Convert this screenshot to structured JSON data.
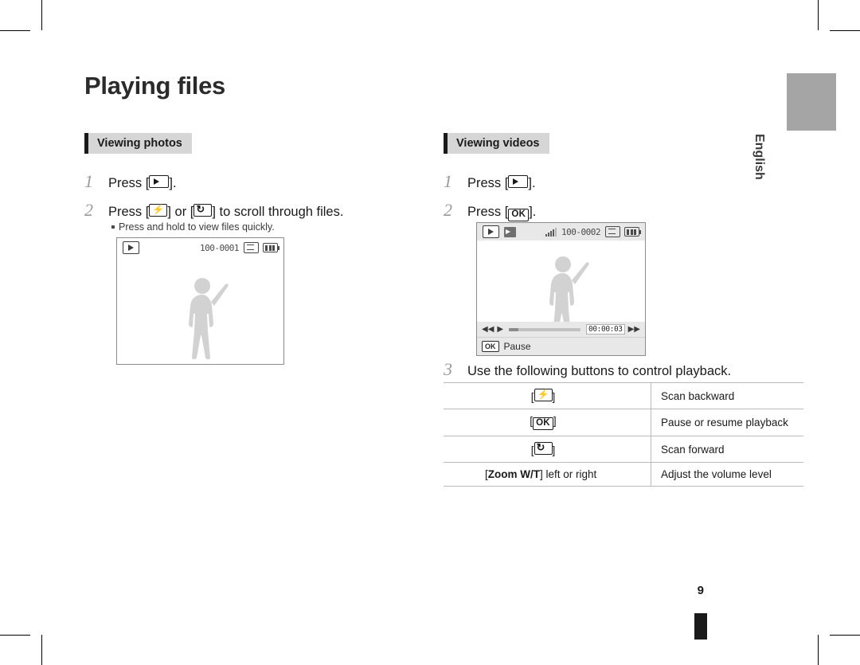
{
  "page": {
    "title": "Playing files",
    "number": "9",
    "side_tab_label": "English"
  },
  "sections": {
    "photos": {
      "heading": "Viewing photos",
      "steps": [
        {
          "num": "1",
          "pre": "Press [",
          "post": "]."
        },
        {
          "num": "2",
          "pre": "Press [",
          "mid": "] or [",
          "post": "] to scroll through files."
        }
      ],
      "note": "Press and hold to view files quickly.",
      "screen": {
        "file_number": "100-0001",
        "icons": [
          "play-icon",
          "memory-card-icon",
          "battery-icon"
        ]
      }
    },
    "videos": {
      "heading": "Viewing videos",
      "steps": [
        {
          "num": "1",
          "pre": "Press [",
          "post": "]."
        },
        {
          "num": "2",
          "pre": "Press [",
          "post": "]."
        },
        {
          "num": "3",
          "text": "Use the following buttons to control playback."
        }
      ],
      "screen": {
        "file_number": "100-0002",
        "timecode": "00:00:03",
        "status_ok": "OK",
        "status_text": "Pause",
        "icons": [
          "play-icon",
          "movie-icon",
          "signal-icon",
          "memory-card-icon",
          "battery-icon",
          "rewind-icon",
          "play-small-icon",
          "fast-forward-icon"
        ]
      },
      "table": {
        "rows": [
          {
            "button": "flash-key",
            "label": "[",
            "label_end": "]",
            "action": "Scan backward"
          },
          {
            "button": "ok-key",
            "label": "[",
            "label_text": "OK",
            "label_end": "]",
            "action": "Pause or resume playback"
          },
          {
            "button": "timer-key",
            "label": "[",
            "label_end": "]",
            "action": "Scan forward"
          },
          {
            "button": "zoom-key",
            "label_pre": "[",
            "label_bold": "Zoom W/T",
            "label_post": "] left or right",
            "action": "Adjust the volume level"
          }
        ]
      }
    }
  },
  "colors": {
    "heading_bg": "#d6d6d6",
    "heading_bar": "#1a1a1a",
    "step_number": "#9a9a9a",
    "side_tab": "#a5a5a5",
    "screen_border": "#8c8c8c",
    "silhouette": "#d0d0d0"
  }
}
